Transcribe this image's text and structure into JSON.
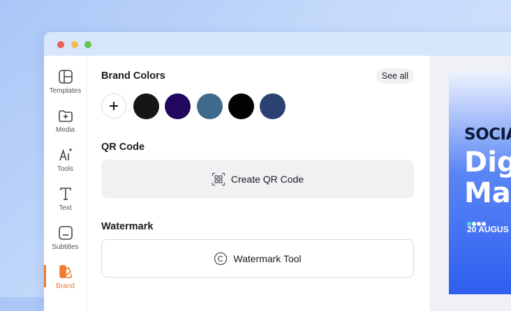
{
  "window": {
    "controls": [
      "close",
      "minimize",
      "maximize"
    ]
  },
  "sidebar": {
    "items": [
      {
        "label": "Templates",
        "icon": "layout-icon"
      },
      {
        "label": "Media",
        "icon": "folder-plus-icon"
      },
      {
        "label": "Tools",
        "icon": "ai-sparkle-icon"
      },
      {
        "label": "Text",
        "icon": "text-icon"
      },
      {
        "label": "Subtitles",
        "icon": "subtitles-icon"
      },
      {
        "label": "Brand",
        "icon": "brand-icon",
        "active": true
      }
    ],
    "accent_color": "#f27a2b"
  },
  "brand_colors": {
    "title": "Brand Colors",
    "see_all_label": "See all",
    "add_label": "+",
    "swatches": [
      "#161618",
      "#22075e",
      "#3d6a8d",
      "#030303",
      "#2a4171"
    ]
  },
  "qr_code": {
    "title": "QR Code",
    "button_label": "Create QR Code"
  },
  "watermark": {
    "title": "Watermark",
    "button_label": "Watermark Tool"
  },
  "preview": {
    "line1": "SOCIAL",
    "line2": "Dig",
    "line3": "Ma",
    "date": "20 AUGUS",
    "dot_colors": [
      "#4fe3c1",
      "#ffffff",
      "#ffffff",
      "#ffffff"
    ]
  }
}
